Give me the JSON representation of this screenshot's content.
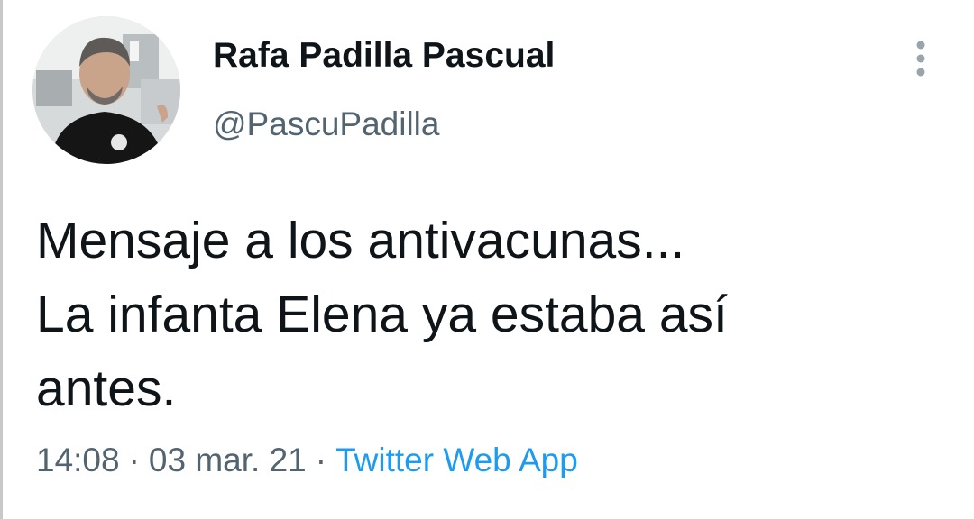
{
  "author": {
    "display_name": "Rafa Padilla Pascual",
    "handle": "@PascuPadilla"
  },
  "tweet": {
    "text": "Mensaje a los antivacunas...\nLa infanta Elena ya estaba así\nantes."
  },
  "meta": {
    "time": "14:08",
    "separator": "·",
    "date": "03 mar. 21",
    "source": "Twitter Web App"
  },
  "icons": {
    "more": "more-vertical-icon",
    "avatar": "profile-photo"
  },
  "colors": {
    "text": "#0f1419",
    "secondary": "#536471",
    "link": "#1d9bf0"
  }
}
